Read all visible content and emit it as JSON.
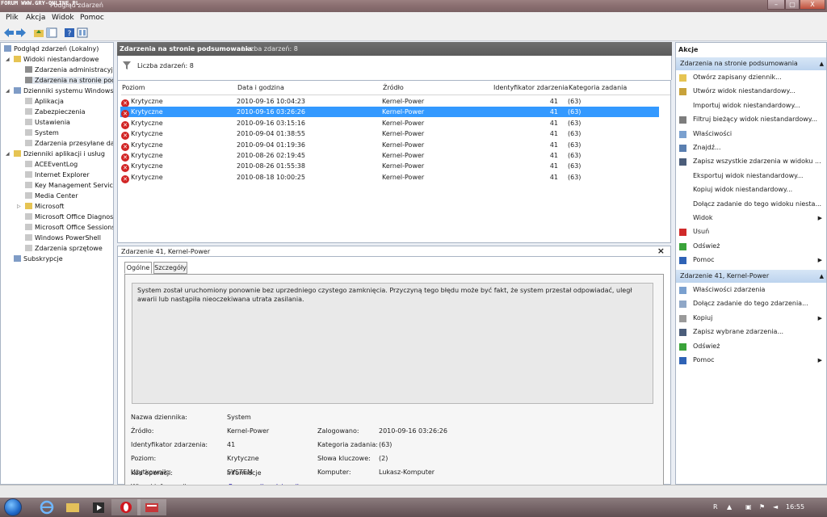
{
  "watermark": "FORUM WWW.GRY-ONLINE.PL",
  "window_title": "Podgląd zdarzeń",
  "window_buttons": {
    "minimize": "–",
    "maximize": "▢",
    "close": "X"
  },
  "menu": [
    "Plik",
    "Akcja",
    "Widok",
    "Pomoc"
  ],
  "toolbar_icons": [
    "back-arrow-icon",
    "forward-arrow-icon",
    "folder-up-icon",
    "show-tree-icon",
    "help-icon",
    "properties-icon"
  ],
  "tree": {
    "root": "Podgląd zdarzeń (Lokalny)",
    "custom": "Widoki niestandardowe",
    "custom_items": [
      "Zdarzenia administracyjne",
      "Zdarzenia na stronie podsumowania"
    ],
    "windows": "Dzienniki systemu Windows",
    "windows_items": [
      "Aplikacja",
      "Zabezpieczenia",
      "Ustawienia",
      "System",
      "Zdarzenia przesyłane dalej"
    ],
    "apps": "Dzienniki aplikacji i usług",
    "apps_items": [
      "ACEEventLog",
      "Internet Explorer",
      "Key Management Service",
      "Media Center",
      "Microsoft",
      "Microsoft Office Diagnostics",
      "Microsoft Office Sessions",
      "Windows PowerShell",
      "Zdarzenia sprzętowe"
    ],
    "subs": "Subskrypcje"
  },
  "center": {
    "title": "Zdarzenia na stronie podsumowania",
    "count_header": "Liczba zdarzeń: 8",
    "count_line": "Liczba zdarzeń: 8"
  },
  "events": {
    "columns": [
      "Poziom",
      "Data i godzina",
      "Źródło",
      "Identyfikator zdarzenia",
      "Kategoria zadania"
    ],
    "rows": [
      [
        "Krytyczne",
        "2010-09-16 10:04:23",
        "Kernel-Power",
        "41",
        "(63)"
      ],
      [
        "Krytyczne",
        "2010-09-16 03:26:26",
        "Kernel-Power",
        "41",
        "(63)"
      ],
      [
        "Krytyczne",
        "2010-09-16 03:15:16",
        "Kernel-Power",
        "41",
        "(63)"
      ],
      [
        "Krytyczne",
        "2010-09-04 01:38:55",
        "Kernel-Power",
        "41",
        "(63)"
      ],
      [
        "Krytyczne",
        "2010-09-04 01:19:36",
        "Kernel-Power",
        "41",
        "(63)"
      ],
      [
        "Krytyczne",
        "2010-08-26 02:19:45",
        "Kernel-Power",
        "41",
        "(63)"
      ],
      [
        "Krytyczne",
        "2010-08-26 01:55:38",
        "Kernel-Power",
        "41",
        "(63)"
      ],
      [
        "Krytyczne",
        "2010-08-18 10:00:25",
        "Kernel-Power",
        "41",
        "(63)"
      ]
    ],
    "selected_row": 1
  },
  "detail": {
    "title": "Zdarzenie 41, Kernel-Power",
    "close": "×",
    "tabs": [
      "Ogólne",
      "Szczegóły"
    ],
    "message": "System został uruchomiony ponownie bez uprzedniego czystego zamknięcia. Przyczyną tego błędu może być fakt, że system przestał odpowiadać, uległ awarii lub nastąpiła nieoczekiwana utrata zasilania.",
    "props": {
      "log_name_label": "Nazwa dziennika:",
      "log_name": "System",
      "source_label": "Źródło:",
      "source": "Kernel-Power",
      "logged_label": "Zalogowano:",
      "logged": "2010-09-16 03:26:26",
      "event_id_label": "Identyfikator zdarzenia:",
      "event_id": "41",
      "task_cat_label": "Kategoria zadania:",
      "task_cat": "(63)",
      "level_label": "Poziom:",
      "level": "Krytyczne",
      "keywords_label": "Słowa kluczowe:",
      "keywords": "(2)",
      "user_label": "Użytkownik:",
      "user": "SYSTEM",
      "computer_label": "Komputer:",
      "computer": "Lukasz-Komputer",
      "opcode_label": "Kod operacji:",
      "opcode": "Informacje",
      "more_info_label": "Więcej informacji:",
      "more_info_link": "Pomoc online dziennika"
    }
  },
  "actions": {
    "title": "Akcje",
    "section1": "Zdarzenia na stronie podsumowania",
    "items1": [
      {
        "label": "Otwórz zapisany dziennik...",
        "icon": "open-folder-icon"
      },
      {
        "label": "Utwórz widok niestandardowy...",
        "icon": "filter-create-icon"
      },
      {
        "label": "Importuj widok niestandardowy...",
        "icon": ""
      },
      {
        "label": "Filtruj bieżący widok niestandardowy...",
        "icon": "filter-icon"
      },
      {
        "label": "Właściwości",
        "icon": "properties-icon"
      },
      {
        "label": "Znajdź...",
        "icon": "find-icon"
      },
      {
        "label": "Zapisz wszystkie zdarzenia w widoku ...",
        "icon": "save-icon"
      },
      {
        "label": "Eksportuj widok niestandardowy...",
        "icon": ""
      },
      {
        "label": "Kopiuj widok niestandardowy...",
        "icon": ""
      },
      {
        "label": "Dołącz zadanie do tego widoku niesta...",
        "icon": ""
      },
      {
        "label": "Widok",
        "icon": "",
        "submenu": true
      },
      {
        "label": "Usuń",
        "icon": "delete-icon"
      },
      {
        "label": "Odśwież",
        "icon": "refresh-icon"
      },
      {
        "label": "Pomoc",
        "icon": "help-icon",
        "submenu": true
      }
    ],
    "section2": "Zdarzenie 41, Kernel-Power",
    "items2": [
      {
        "label": "Właściwości zdarzenia",
        "icon": "event-properties-icon"
      },
      {
        "label": "Dołącz zadanie do tego zdarzenia...",
        "icon": "attach-task-icon"
      },
      {
        "label": "Kopiuj",
        "icon": "copy-icon",
        "submenu": true
      },
      {
        "label": "Zapisz wybrane zdarzenia...",
        "icon": "save-icon"
      },
      {
        "label": "Odśwież",
        "icon": "refresh-icon"
      },
      {
        "label": "Pomoc",
        "icon": "help-icon",
        "submenu": true
      }
    ]
  },
  "taskbar": {
    "apps": [
      "internet-explorer-icon",
      "explorer-folder-icon",
      "media-player-icon",
      "opera-icon",
      "event-viewer-icon"
    ],
    "language": "R",
    "clock": "16:55"
  },
  "colors": {
    "selection": "#3399ff",
    "critical": "#d22525",
    "link": "#1a0dab",
    "section": "#cfe0f3"
  }
}
